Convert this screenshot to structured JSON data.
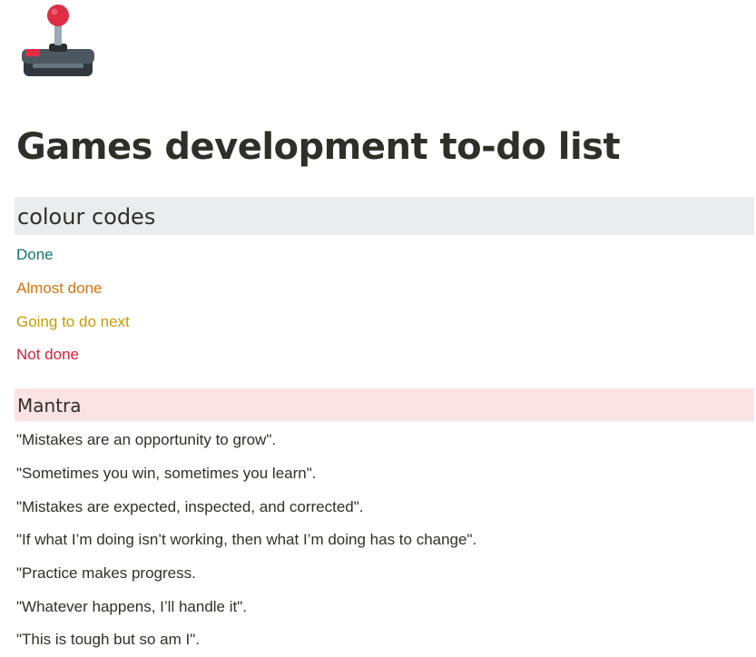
{
  "page": {
    "icon": "joystick-icon",
    "title": "Games development to-do list"
  },
  "colour_codes": {
    "heading": "colour codes",
    "heading_background": "#ebecee",
    "items": [
      {
        "label": "Done",
        "color": "#0f7b6c"
      },
      {
        "label": "Almost done",
        "color": "#d9730d"
      },
      {
        "label": "Going to do next",
        "color": "#cb9b00"
      },
      {
        "label": "Not done",
        "color": "#d5223b"
      }
    ]
  },
  "mantra": {
    "heading": "Mantra",
    "heading_background": "#fbe3e4",
    "lines": [
      "\"Mistakes are an opportunity to grow\".",
      "\"Sometimes you win, sometimes you learn\".",
      "\"Mistakes are expected, inspected, and corrected\".",
      "\"If what I’m doing isn’t working, then what I’m doing has to change\".",
      "\"Practice makes progress.",
      "\"Whatever happens, I’ll handle it\".",
      "\"This is tough but so am I\"."
    ]
  }
}
